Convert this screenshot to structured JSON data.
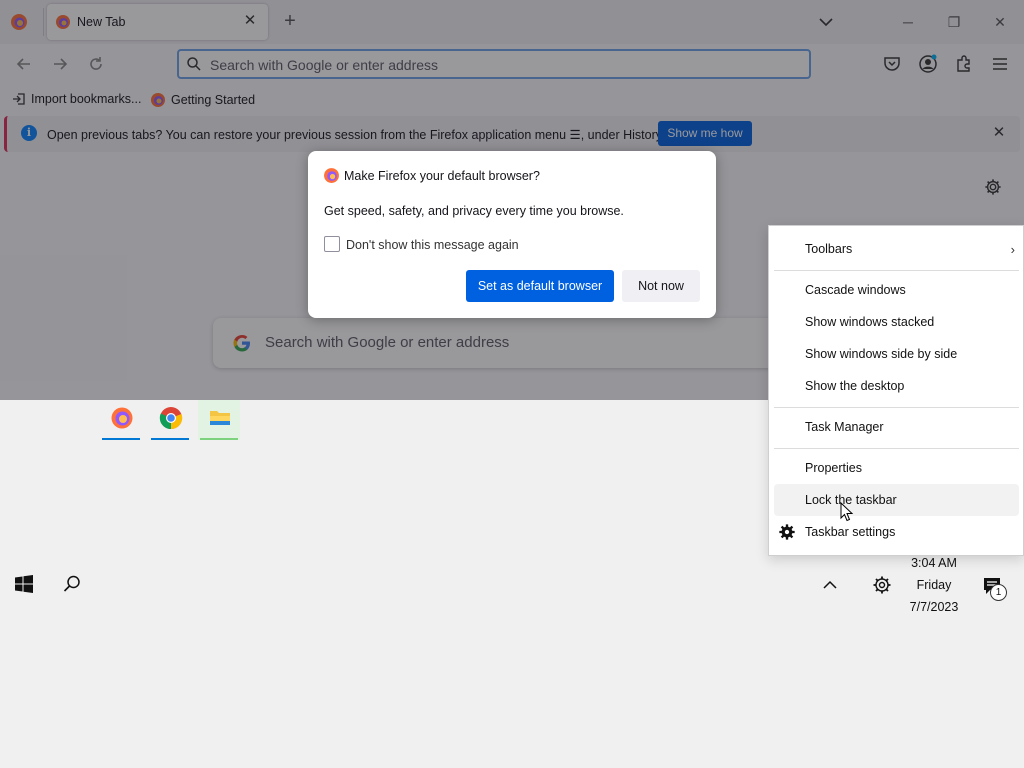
{
  "browser": {
    "tab": {
      "title": "New Tab"
    },
    "address_bar": {
      "placeholder": "Search with Google or enter address"
    },
    "bookmarks": [
      {
        "label": "Import bookmarks..."
      },
      {
        "label": "Getting Started"
      }
    ],
    "infobar": {
      "message": "Open previous tabs? You can restore your previous session from the Firefox application menu ☰, under History.",
      "button": "Show me how"
    },
    "content_search": {
      "placeholder": "Search with Google or enter address"
    }
  },
  "dialog": {
    "title": "Make Firefox your default browser?",
    "description": "Get speed, safety, and privacy every time you browse.",
    "checkbox_label": "Don't show this message again",
    "primary_button": "Set as default browser",
    "secondary_button": "Not now"
  },
  "context_menu": {
    "items": [
      {
        "label": "Toolbars",
        "submenu": true
      },
      {
        "label": "Cascade windows"
      },
      {
        "label": "Show windows stacked"
      },
      {
        "label": "Show windows side by side"
      },
      {
        "label": "Show the desktop"
      },
      {
        "label": "Task Manager"
      },
      {
        "label": "Properties"
      },
      {
        "label": "Lock the taskbar",
        "hovered": true
      },
      {
        "label": "Taskbar settings",
        "icon": "gear-icon"
      }
    ]
  },
  "taskbar": {
    "apps": [
      {
        "name": "firefox-icon",
        "active": true
      },
      {
        "name": "chrome-icon",
        "active": true
      },
      {
        "name": "file-explorer-icon",
        "active": false
      }
    ],
    "clock": {
      "time": "3:04 AM",
      "day": "Friday",
      "date": "7/7/2023"
    },
    "notifications": {
      "count": "1"
    }
  },
  "colors": {
    "accent": "#0061e0",
    "infobar_stripe": "#e02a5b",
    "urlbar_focus": "#6aa3e8"
  }
}
